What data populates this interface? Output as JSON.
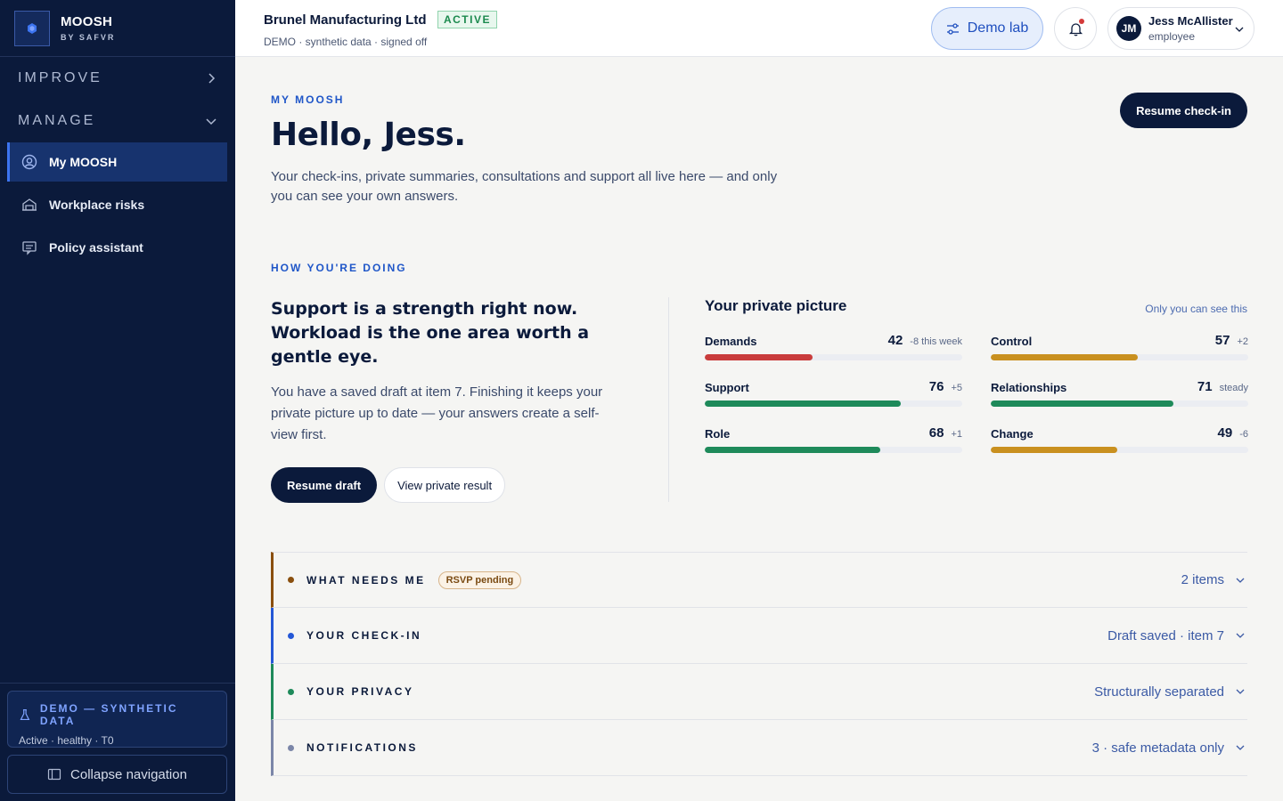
{
  "brand": {
    "name": "MOOSH",
    "sub": "BY SAFVR"
  },
  "sidebar": {
    "sections": [
      {
        "label": "IMPROVE"
      },
      {
        "label": "MANAGE"
      }
    ],
    "items": [
      {
        "label": "My MOOSH"
      },
      {
        "label": "Workplace risks"
      },
      {
        "label": "Policy assistant"
      }
    ],
    "demo": {
      "title": "DEMO — SYNTHETIC DATA",
      "sub": "Active · healthy · T0"
    },
    "collapse_label": "Collapse navigation"
  },
  "topbar": {
    "org_name": "Brunel Manufacturing Ltd",
    "status": "ACTIVE",
    "org_sub": "DEMO · synthetic data · signed off",
    "demo_lab": "Demo lab",
    "user": {
      "initials": "JM",
      "name": "Jess McAllister",
      "role": "employee"
    }
  },
  "main": {
    "eyebrow": "MY MOOSH",
    "greeting": "Hello, Jess.",
    "intro": "Your check-ins, private summaries, consultations and support all live here — and only you can see your own answers.",
    "resume_checkin": "Resume check-in"
  },
  "doing": {
    "eyebrow": "HOW YOU'RE DOING",
    "headline": "Support is a strength right now. Workload is the one area worth a gentle eye.",
    "body": "You have a saved draft at item 7. Finishing it keeps your private picture up to date — your answers create a self-view first.",
    "resume_draft": "Resume draft",
    "view_result": "View private result"
  },
  "picture": {
    "title": "Your private picture",
    "note": "Only you can see this",
    "metrics": [
      {
        "label": "Demands",
        "score": 42,
        "delta": "-8 this week",
        "color": "#c93c3c"
      },
      {
        "label": "Control",
        "score": 57,
        "delta": "+2",
        "color": "#c9901f"
      },
      {
        "label": "Support",
        "score": 76,
        "delta": "+5",
        "color": "#1e8a5a"
      },
      {
        "label": "Relationships",
        "score": 71,
        "delta": "steady",
        "color": "#1e8a5a"
      },
      {
        "label": "Role",
        "score": 68,
        "delta": "+1",
        "color": "#1e8a5a"
      },
      {
        "label": "Change",
        "score": 49,
        "delta": "-6",
        "color": "#c9901f"
      }
    ]
  },
  "accordions": [
    {
      "title": "WHAT NEEDS ME",
      "pill": "RSVP pending",
      "meta": "2 items",
      "color": "#8a4f0e"
    },
    {
      "title": "YOUR CHECK-IN",
      "meta": "Draft saved · item 7",
      "color": "#2457d6"
    },
    {
      "title": "YOUR PRIVACY",
      "meta": "Structurally separated",
      "color": "#1e8a5a"
    },
    {
      "title": "NOTIFICATIONS",
      "meta": "3 · safe metadata only",
      "color": "#7b86a8"
    }
  ]
}
